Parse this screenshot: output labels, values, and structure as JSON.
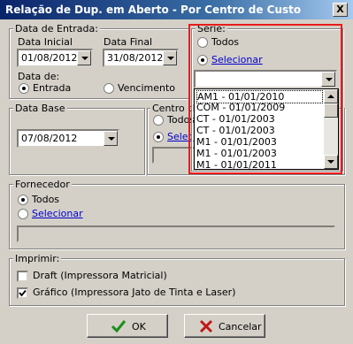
{
  "window": {
    "title": "Relação de Dup. em Aberto - Por Centro de Custo",
    "close_label": "X"
  },
  "data_entrada": {
    "legend": "Data de Entrada:",
    "data_inicial_label": "Data Inicial",
    "data_inicial_value": "01/08/2012",
    "data_final_label": "Data Final",
    "data_final_value": "31/08/2012",
    "data_de_label": "Data de:",
    "entrada_label": "Entrada",
    "vencimento_label": "Vencimento",
    "selected": "Entrada"
  },
  "data_base": {
    "legend": "Data Base",
    "value": "07/08/2012"
  },
  "centro": {
    "legend": "Centro de",
    "todos_label": "Todos",
    "selecionar_label": "Selec",
    "selected": "Selecionar"
  },
  "serie": {
    "legend": "Série:",
    "todos_label": "Todos",
    "selecionar_label": "Selecionar",
    "selected": "Selecionar",
    "combo_value": "",
    "options": [
      "AM1 - 01/01/2010",
      "COM - 01/01/2009",
      "CT  - 01/01/2003",
      "CT - 01/01/2003",
      "M1  - 01/01/2003",
      "M1 - 01/01/2003",
      "M1  - 01/01/2011"
    ],
    "highlight_color": "#e81c1c"
  },
  "fornecedor": {
    "legend": "Fornecedor",
    "todos_label": "Todos",
    "selecionar_label": "Selecionar",
    "selected": "Todos"
  },
  "imprimir": {
    "legend": "Imprimir:",
    "draft_label": "Draft (Impressora Matricial)",
    "draft_checked": false,
    "grafico_label": "Gráfico (Impressora Jato de Tinta e Laser)",
    "grafico_checked": true
  },
  "buttons": {
    "ok_label": "OK",
    "cancel_label": "Cancelar"
  },
  "icons": {
    "ok": "check-icon",
    "cancel": "x-icon"
  }
}
